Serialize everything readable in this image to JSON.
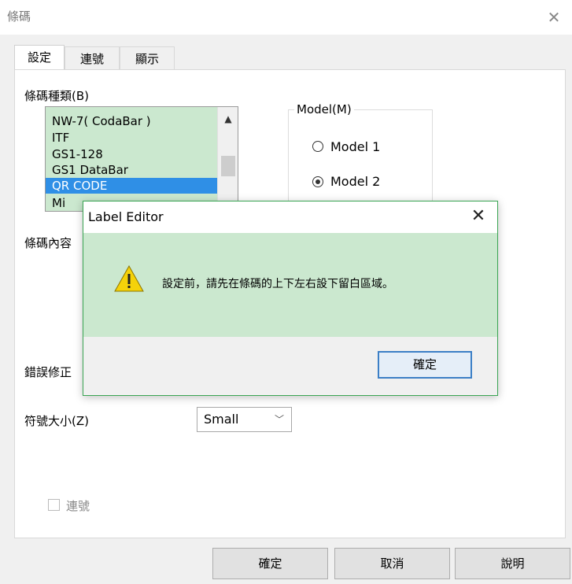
{
  "window": {
    "title": "條碼",
    "close_glyph": "✕"
  },
  "tabs": [
    {
      "label": "設定",
      "active": true
    },
    {
      "label": "連號",
      "active": false
    },
    {
      "label": "顯示",
      "active": false
    }
  ],
  "settings": {
    "barcode_type_label": "條碼種類(B)",
    "barcode_types": [
      "NW-7( CodaBar )",
      "ITF",
      "GS1-128",
      "GS1 DataBar",
      "QR CODE"
    ],
    "barcode_type_next_partial": "Mi",
    "selected_type": "QR CODE",
    "content_label": "條碼內容",
    "error_label": "錯誤修正",
    "symbol_size_label": "符號大小(Z)",
    "symbol_size_value": "Small",
    "serial_checkbox_label": "連號",
    "serial_checked": false
  },
  "model_group": {
    "title": "Model(M)",
    "options": [
      {
        "label": "Model 1",
        "selected": false
      },
      {
        "label": "Model 2",
        "selected": true
      }
    ]
  },
  "buttons": {
    "ok": "確定",
    "cancel": "取消",
    "help": "說明"
  },
  "alert": {
    "title": "Label Editor",
    "close_glyph": "✕",
    "message": "設定前，請先在條碼的上下左右設下留白區域。",
    "ok": "確定",
    "icon": "warning-icon"
  },
  "colors": {
    "accent": "#2f8fe6",
    "highlight_green": "#cbe8cf",
    "dialog_border": "#3aa553"
  }
}
